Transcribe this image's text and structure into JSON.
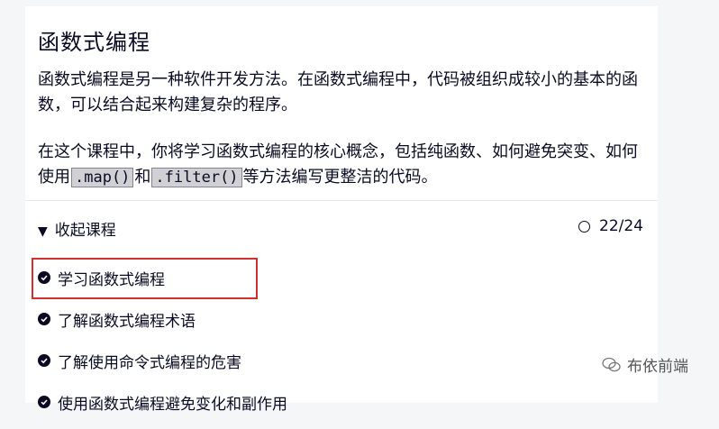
{
  "card": {
    "title": "函数式编程",
    "desc1": "函数式编程是另一种软件开发方法。在函数式编程中，代码被组织成较小的基本的函数，可以结合起来构建复杂的程序。",
    "desc2_part1": "在这个课程中，你将学习函数式编程的核心概念，包括纯函数、如何避免突变、如何使用",
    "desc2_code1": ".map()",
    "desc2_part2": "和",
    "desc2_code2": ".filter()",
    "desc2_part3": "等方法编写更整洁的代码。"
  },
  "course": {
    "toggle_label": "收起课程",
    "progress": "22/24",
    "steps": [
      {
        "label": "学习函数式编程"
      },
      {
        "label": "了解函数式编程术语"
      },
      {
        "label": "了解使用命令式编程的危害"
      },
      {
        "label": "使用函数式编程避免变化和副作用"
      }
    ]
  },
  "watermark": {
    "text": "布依前端"
  }
}
